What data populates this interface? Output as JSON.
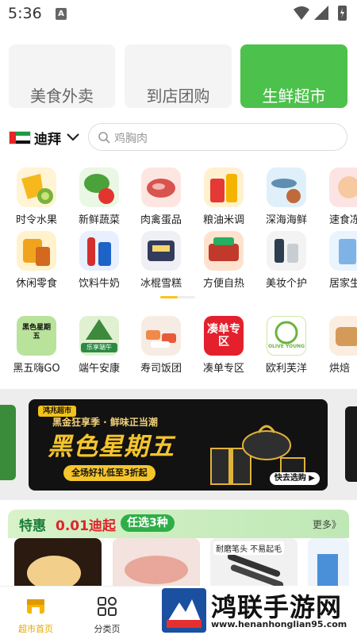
{
  "status_bar": {
    "time": "5:36",
    "notification_letter": "A"
  },
  "top_tabs": [
    {
      "label": "美食外卖",
      "active": false
    },
    {
      "label": "到店团购",
      "active": false
    },
    {
      "label": "生鲜超市",
      "active": true
    }
  ],
  "location": {
    "city": "迪拜",
    "flag": "uae-flag-icon"
  },
  "search": {
    "placeholder": "鸡胸肉"
  },
  "categories_row1": [
    {
      "label": "时令水果",
      "icon": "fruit-icon"
    },
    {
      "label": "新鲜蔬菜",
      "icon": "vegetable-icon"
    },
    {
      "label": "肉禽蛋品",
      "icon": "meat-icon"
    },
    {
      "label": "粮油米调",
      "icon": "grain-oil-icon"
    },
    {
      "label": "深海海鲜",
      "icon": "seafood-icon"
    },
    {
      "label": "速食冻",
      "icon": "frozen-food-icon"
    }
  ],
  "categories_row2": [
    {
      "label": "休闲零食",
      "icon": "snack-icon"
    },
    {
      "label": "饮料牛奶",
      "icon": "drink-icon"
    },
    {
      "label": "冰棍雪糕",
      "icon": "ice-cream-icon"
    },
    {
      "label": "方便自热",
      "icon": "instant-food-icon"
    },
    {
      "label": "美妆个护",
      "icon": "beauty-icon"
    },
    {
      "label": "居家生",
      "icon": "home-icon"
    }
  ],
  "categories_row3": [
    {
      "label": "黑五嗨GO",
      "icon": "black-friday-icon",
      "badge_text": "黑色星期五"
    },
    {
      "label": "端午安康",
      "icon": "dragon-boat-icon",
      "badge_text": "乐享端午"
    },
    {
      "label": "寿司饭团",
      "icon": "sushi-icon"
    },
    {
      "label": "凑单专区",
      "icon": "bundle-icon",
      "badge_text": "凑单专区"
    },
    {
      "label": "欧利芙洋",
      "icon": "olive-young-icon",
      "badge_text": "OLIVE YOUNG"
    },
    {
      "label": "烘焙",
      "icon": "bakery-icon"
    }
  ],
  "promo": {
    "brand": "鸿兆超市",
    "subtitle": "黑金狂享季 · 鲜味正当潮",
    "title": "黑色星期五",
    "discount": "全场好礼低至3折起",
    "cta": "快去选购 ▶"
  },
  "special": {
    "title": "特惠",
    "price": "0.01迪起",
    "pill": "任选3种",
    "more": "更多》",
    "product_tag": "耐磨笔头 不易起毛"
  },
  "bottom_nav": [
    {
      "label": "超市首页",
      "icon": "store-icon",
      "active": true
    },
    {
      "label": "分类页",
      "icon": "grid-icon",
      "active": false
    }
  ],
  "watermark": {
    "title": "鸿联手游网",
    "url": "www.henanhonglian95.com"
  },
  "colors": {
    "accent_green": "#4cc14b",
    "accent_yellow": "#f5c52c",
    "nav_active": "#e6a700"
  }
}
